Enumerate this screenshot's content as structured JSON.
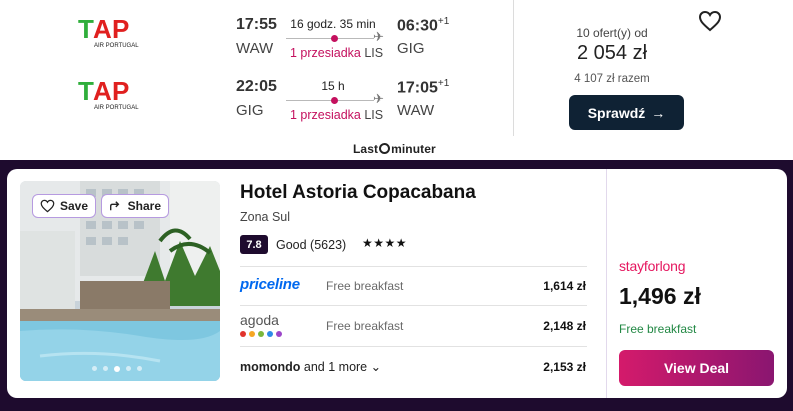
{
  "flight": {
    "legs": [
      {
        "airline_logo_text": "TAP",
        "airline_sub": "AIR PORTUGAL",
        "dep_time": "17:55",
        "dep_code": "WAW",
        "duration": "16 godz. 35 min",
        "stops_label": "1 przesiadka",
        "stop_code": "LIS",
        "arr_time": "06:30",
        "arr_day": "+1",
        "arr_code": "GIG"
      },
      {
        "airline_logo_text": "TAP",
        "airline_sub": "AIR PORTUGAL",
        "dep_time": "22:05",
        "dep_code": "GIG",
        "duration": "15 h",
        "stops_label": "1 przesiadka",
        "stop_code": "LIS",
        "arr_time": "17:05",
        "arr_day": "+1",
        "arr_code": "WAW"
      }
    ],
    "offers_label": "10 ofert(y) od",
    "price": "2 054 zł",
    "total": "4 107 zł razem",
    "check_button": "Sprawdź",
    "provider_brand_a": "Last",
    "provider_brand_b": "minuter"
  },
  "hotel": {
    "save_label": "Save",
    "share_label": "Share",
    "name": "Hotel Astoria Copacabana",
    "area": "Zona Sul",
    "score": "7.8",
    "rating_text": "Good (5623)",
    "stars": "★★★★",
    "providers": [
      {
        "name": "priceline",
        "note": "Free breakfast",
        "price": "1,614 zł"
      },
      {
        "name": "agoda",
        "note": "Free breakfast",
        "price": "2,148 zł"
      }
    ],
    "momondo_name": "momondo",
    "momondo_more": "and 1 more",
    "momondo_price": "2,153 zł",
    "featured_provider": "stayforlong",
    "featured_price": "1,496 zł",
    "featured_note": "Free breakfast",
    "deal_button": "View Deal",
    "carousel_active_index": 2,
    "carousel_count": 5
  },
  "colors": {
    "accent_pink": "#c4105e",
    "navy": "#0f2234",
    "brand_purple": "#1e0b2e",
    "priceline_blue": "#0068ef",
    "stayforlong": "#e5175f"
  }
}
